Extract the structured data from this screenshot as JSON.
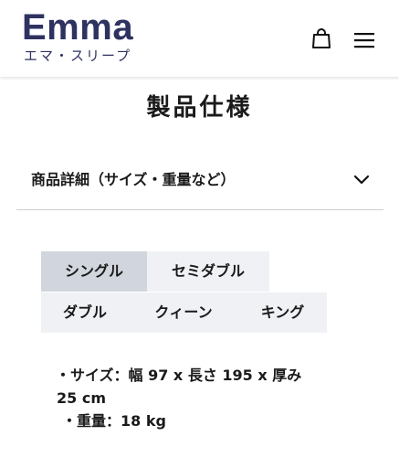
{
  "header": {
    "logo_text": "Emma",
    "logo_subtitle": "エマ・スリープ",
    "brand_color": "#2e3260",
    "icons": [
      "shopping-bag-icon",
      "hamburger-menu-icon"
    ]
  },
  "page": {
    "title": "製品仕様"
  },
  "accordion": {
    "label": "商品詳細（サイズ・重量など）",
    "icon": "chevron-down-icon"
  },
  "tabs": {
    "items": [
      {
        "label": "シングル",
        "active": true
      },
      {
        "label": "セミダブル",
        "active": false
      },
      {
        "label": "ダブル",
        "active": false
      },
      {
        "label": "クィーン",
        "active": false
      },
      {
        "label": "キング",
        "active": false
      }
    ],
    "active_color": "#d1d6de",
    "inactive_color": "#eff1f4"
  },
  "specs": {
    "size_line_1": "・サイズ：幅 97 x 長さ 195 x 厚み",
    "size_line_2": "25 cm",
    "weight_line": "・重量：18 kg"
  }
}
